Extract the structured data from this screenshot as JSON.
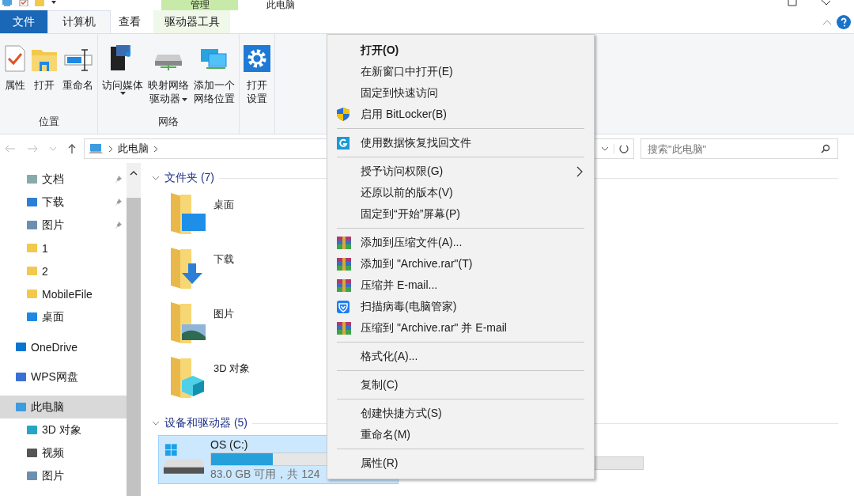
{
  "title_bar": {
    "context_tab": "管理",
    "title": "此电脑"
  },
  "ribbon_tabs": [
    {
      "label": "文件",
      "kind": "file",
      "selected": false
    },
    {
      "label": "计算机",
      "kind": "tab",
      "selected": true
    },
    {
      "label": "查看",
      "kind": "tab",
      "selected": false
    },
    {
      "label": "驱动器工具",
      "kind": "context",
      "selected": false
    }
  ],
  "ribbon_groups": [
    {
      "label": "位置",
      "buttons": [
        {
          "lines": [
            "属性"
          ],
          "dropdown": false
        },
        {
          "lines": [
            "打开"
          ],
          "dropdown": false
        },
        {
          "lines": [
            "重命名"
          ],
          "dropdown": false
        }
      ]
    },
    {
      "label": "网络",
      "buttons": [
        {
          "lines": [
            "访问媒体"
          ],
          "dropdown": true
        },
        {
          "lines": [
            "映射网络",
            "驱动器"
          ],
          "dropdown": true
        },
        {
          "lines": [
            "添加一个",
            "网络位置"
          ],
          "dropdown": false
        }
      ]
    },
    {
      "buttons": [
        {
          "lines": [
            "打开",
            "设置"
          ],
          "dropdown": false
        }
      ]
    }
  ],
  "address": {
    "path": [
      "此电脑"
    ],
    "search_placeholder": "搜索\"此电脑\""
  },
  "sidebar": {
    "items": [
      {
        "label": "文档",
        "kind": "quick",
        "pinned": true
      },
      {
        "label": "下载",
        "kind": "quick",
        "pinned": true
      },
      {
        "label": "图片",
        "kind": "quick",
        "pinned": true
      },
      {
        "label": "1",
        "kind": "quick",
        "pinned": false
      },
      {
        "label": "2",
        "kind": "quick",
        "pinned": false
      },
      {
        "label": "MobileFile",
        "kind": "quick",
        "pinned": false
      },
      {
        "label": "桌面",
        "kind": "quick",
        "pinned": false
      },
      {
        "label": "OneDrive",
        "kind": "root",
        "selected": false
      },
      {
        "label": "WPS网盘",
        "kind": "root",
        "selected": false
      },
      {
        "label": "此电脑",
        "kind": "root",
        "selected": true,
        "children": [
          {
            "label": "3D 对象"
          },
          {
            "label": "视频"
          },
          {
            "label": "图片"
          }
        ]
      }
    ]
  },
  "sections": [
    {
      "title": "文件夹 (7)",
      "kind": "folders",
      "items": [
        {
          "label": "桌面"
        },
        {
          "label": "下载"
        },
        {
          "label": "图片"
        },
        {
          "label": "3D 对象"
        }
      ]
    },
    {
      "title": "设备和驱动器 (5)",
      "kind": "drives",
      "items": [
        {
          "label": "OS (C:)",
          "level": 0.33,
          "info": "83.0 GB 可用，共 124",
          "selected": true
        }
      ]
    }
  ],
  "context_menu": [
    {
      "kind": "item",
      "label": "打开(O)",
      "default": true
    },
    {
      "kind": "item",
      "label": "在新窗口中打开(E)"
    },
    {
      "kind": "item",
      "label": "固定到快速访问"
    },
    {
      "kind": "item",
      "label": "启用 BitLocker(B)"
    },
    {
      "kind": "separator"
    },
    {
      "kind": "item",
      "label": "使用数据恢复找回文件"
    },
    {
      "kind": "separator"
    },
    {
      "kind": "item",
      "label": "授予访问权限(G)",
      "submenu": true
    },
    {
      "kind": "item",
      "label": "还原以前的版本(V)"
    },
    {
      "kind": "item",
      "label": "固定到“开始”屏幕(P)"
    },
    {
      "kind": "separator"
    },
    {
      "kind": "item",
      "label": "添加到压缩文件(A)..."
    },
    {
      "kind": "item",
      "label": "添加到 \"Archive.rar\"(T)"
    },
    {
      "kind": "item",
      "label": "压缩并 E-mail..."
    },
    {
      "kind": "item",
      "label": "扫描病毒(电脑管家)"
    },
    {
      "kind": "item",
      "label": "压缩到 \"Archive.rar\" 并 E-mail"
    },
    {
      "kind": "separator"
    },
    {
      "kind": "item",
      "label": "格式化(A)..."
    },
    {
      "kind": "separator"
    },
    {
      "kind": "item",
      "label": "复制(C)"
    },
    {
      "kind": "separator"
    },
    {
      "kind": "item",
      "label": "创建快捷方式(S)"
    },
    {
      "kind": "item",
      "label": "重命名(M)"
    },
    {
      "kind": "separator"
    },
    {
      "kind": "item",
      "label": "属性(R)"
    }
  ]
}
